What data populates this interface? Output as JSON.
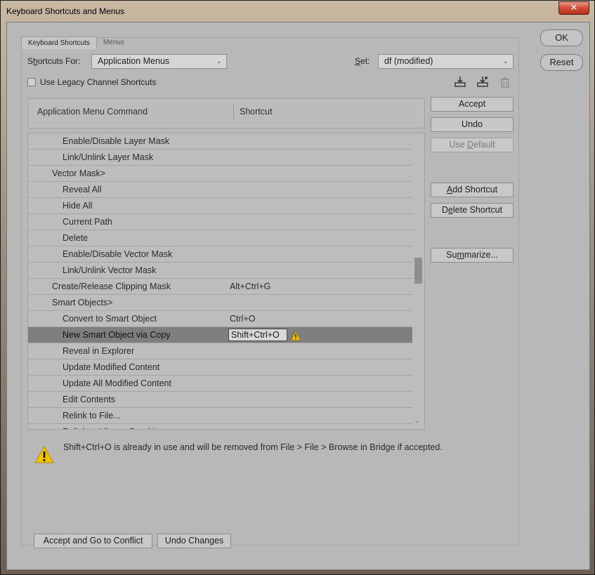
{
  "window": {
    "title": "Keyboard Shortcuts and Menus",
    "close_label": "✕"
  },
  "tabs": [
    {
      "label": "Keyboard Shortcuts"
    },
    {
      "label": "Menus"
    }
  ],
  "shortcuts_for": {
    "label_pre": "S",
    "label_ul": "h",
    "label_post": "ortcuts For:",
    "value": "Application Menus"
  },
  "set": {
    "label_ul": "S",
    "label_post": "et:",
    "value": "df (modified)"
  },
  "legacy_checkbox": {
    "label": "Use Legacy Channel Shortcuts",
    "checked": false
  },
  "icons": [
    "save-set-icon",
    "new-set-icon",
    "delete-set-icon"
  ],
  "table": {
    "headers": {
      "command": "Application Menu Command",
      "shortcut": "Shortcut"
    },
    "rows": [
      {
        "cmd": "Enable/Disable Layer Mask",
        "indent": 2,
        "shortcut": ""
      },
      {
        "cmd": "Link/Unlink Layer Mask",
        "indent": 2,
        "shortcut": ""
      },
      {
        "cmd": "Vector Mask>",
        "indent": 1,
        "shortcut": ""
      },
      {
        "cmd": "Reveal All",
        "indent": 2,
        "shortcut": ""
      },
      {
        "cmd": "Hide All",
        "indent": 2,
        "shortcut": ""
      },
      {
        "cmd": "Current Path",
        "indent": 2,
        "shortcut": ""
      },
      {
        "cmd": "Delete",
        "indent": 2,
        "shortcut": ""
      },
      {
        "cmd": "Enable/Disable Vector Mask",
        "indent": 2,
        "shortcut": ""
      },
      {
        "cmd": "Link/Unlink Vector Mask",
        "indent": 2,
        "shortcut": ""
      },
      {
        "cmd": "Create/Release Clipping Mask",
        "indent": 1,
        "shortcut": "Alt+Ctrl+G"
      },
      {
        "cmd": "Smart Objects>",
        "indent": 1,
        "shortcut": ""
      },
      {
        "cmd": "Convert to Smart Object",
        "indent": 2,
        "shortcut": "Ctrl+O"
      },
      {
        "cmd": "New Smart Object via Copy",
        "indent": 2,
        "shortcut": "Shift+Ctrl+O",
        "selected": true,
        "conflict": true
      },
      {
        "cmd": "Reveal in Explorer",
        "indent": 2,
        "shortcut": ""
      },
      {
        "cmd": "Update Modified Content",
        "indent": 2,
        "shortcut": ""
      },
      {
        "cmd": "Update All Modified Content",
        "indent": 2,
        "shortcut": ""
      },
      {
        "cmd": "Edit Contents",
        "indent": 2,
        "shortcut": ""
      },
      {
        "cmd": "Relink to File...",
        "indent": 2,
        "shortcut": ""
      },
      {
        "cmd": "Relink to Library Graphic...",
        "indent": 2,
        "shortcut": ""
      }
    ]
  },
  "side_buttons": {
    "accept": "Accept",
    "undo": "Undo",
    "use_default_pre": "Use ",
    "use_default_ul": "D",
    "use_default_post": "efault",
    "add_shortcut_ul": "A",
    "add_shortcut_post": "dd Shortcut",
    "delete_shortcut_pre": "D",
    "delete_shortcut_ul": "e",
    "delete_shortcut_post": "lete Shortcut",
    "summarize_pre": "Su",
    "summarize_ul": "m",
    "summarize_post": "marize..."
  },
  "dialog_buttons": {
    "ok": "OK",
    "reset": "Reset"
  },
  "conflict_message": "Shift+Ctrl+O is already in use and will be removed from File > File > Browse in Bridge if accepted.",
  "footer_buttons": {
    "accept_go": "Accept and Go to Conflict",
    "undo_changes": "Undo Changes"
  },
  "colors": {
    "warning": "#f2c300",
    "selected_row": "#7f7f7f",
    "dialog_bg": "#b8b8b8"
  }
}
